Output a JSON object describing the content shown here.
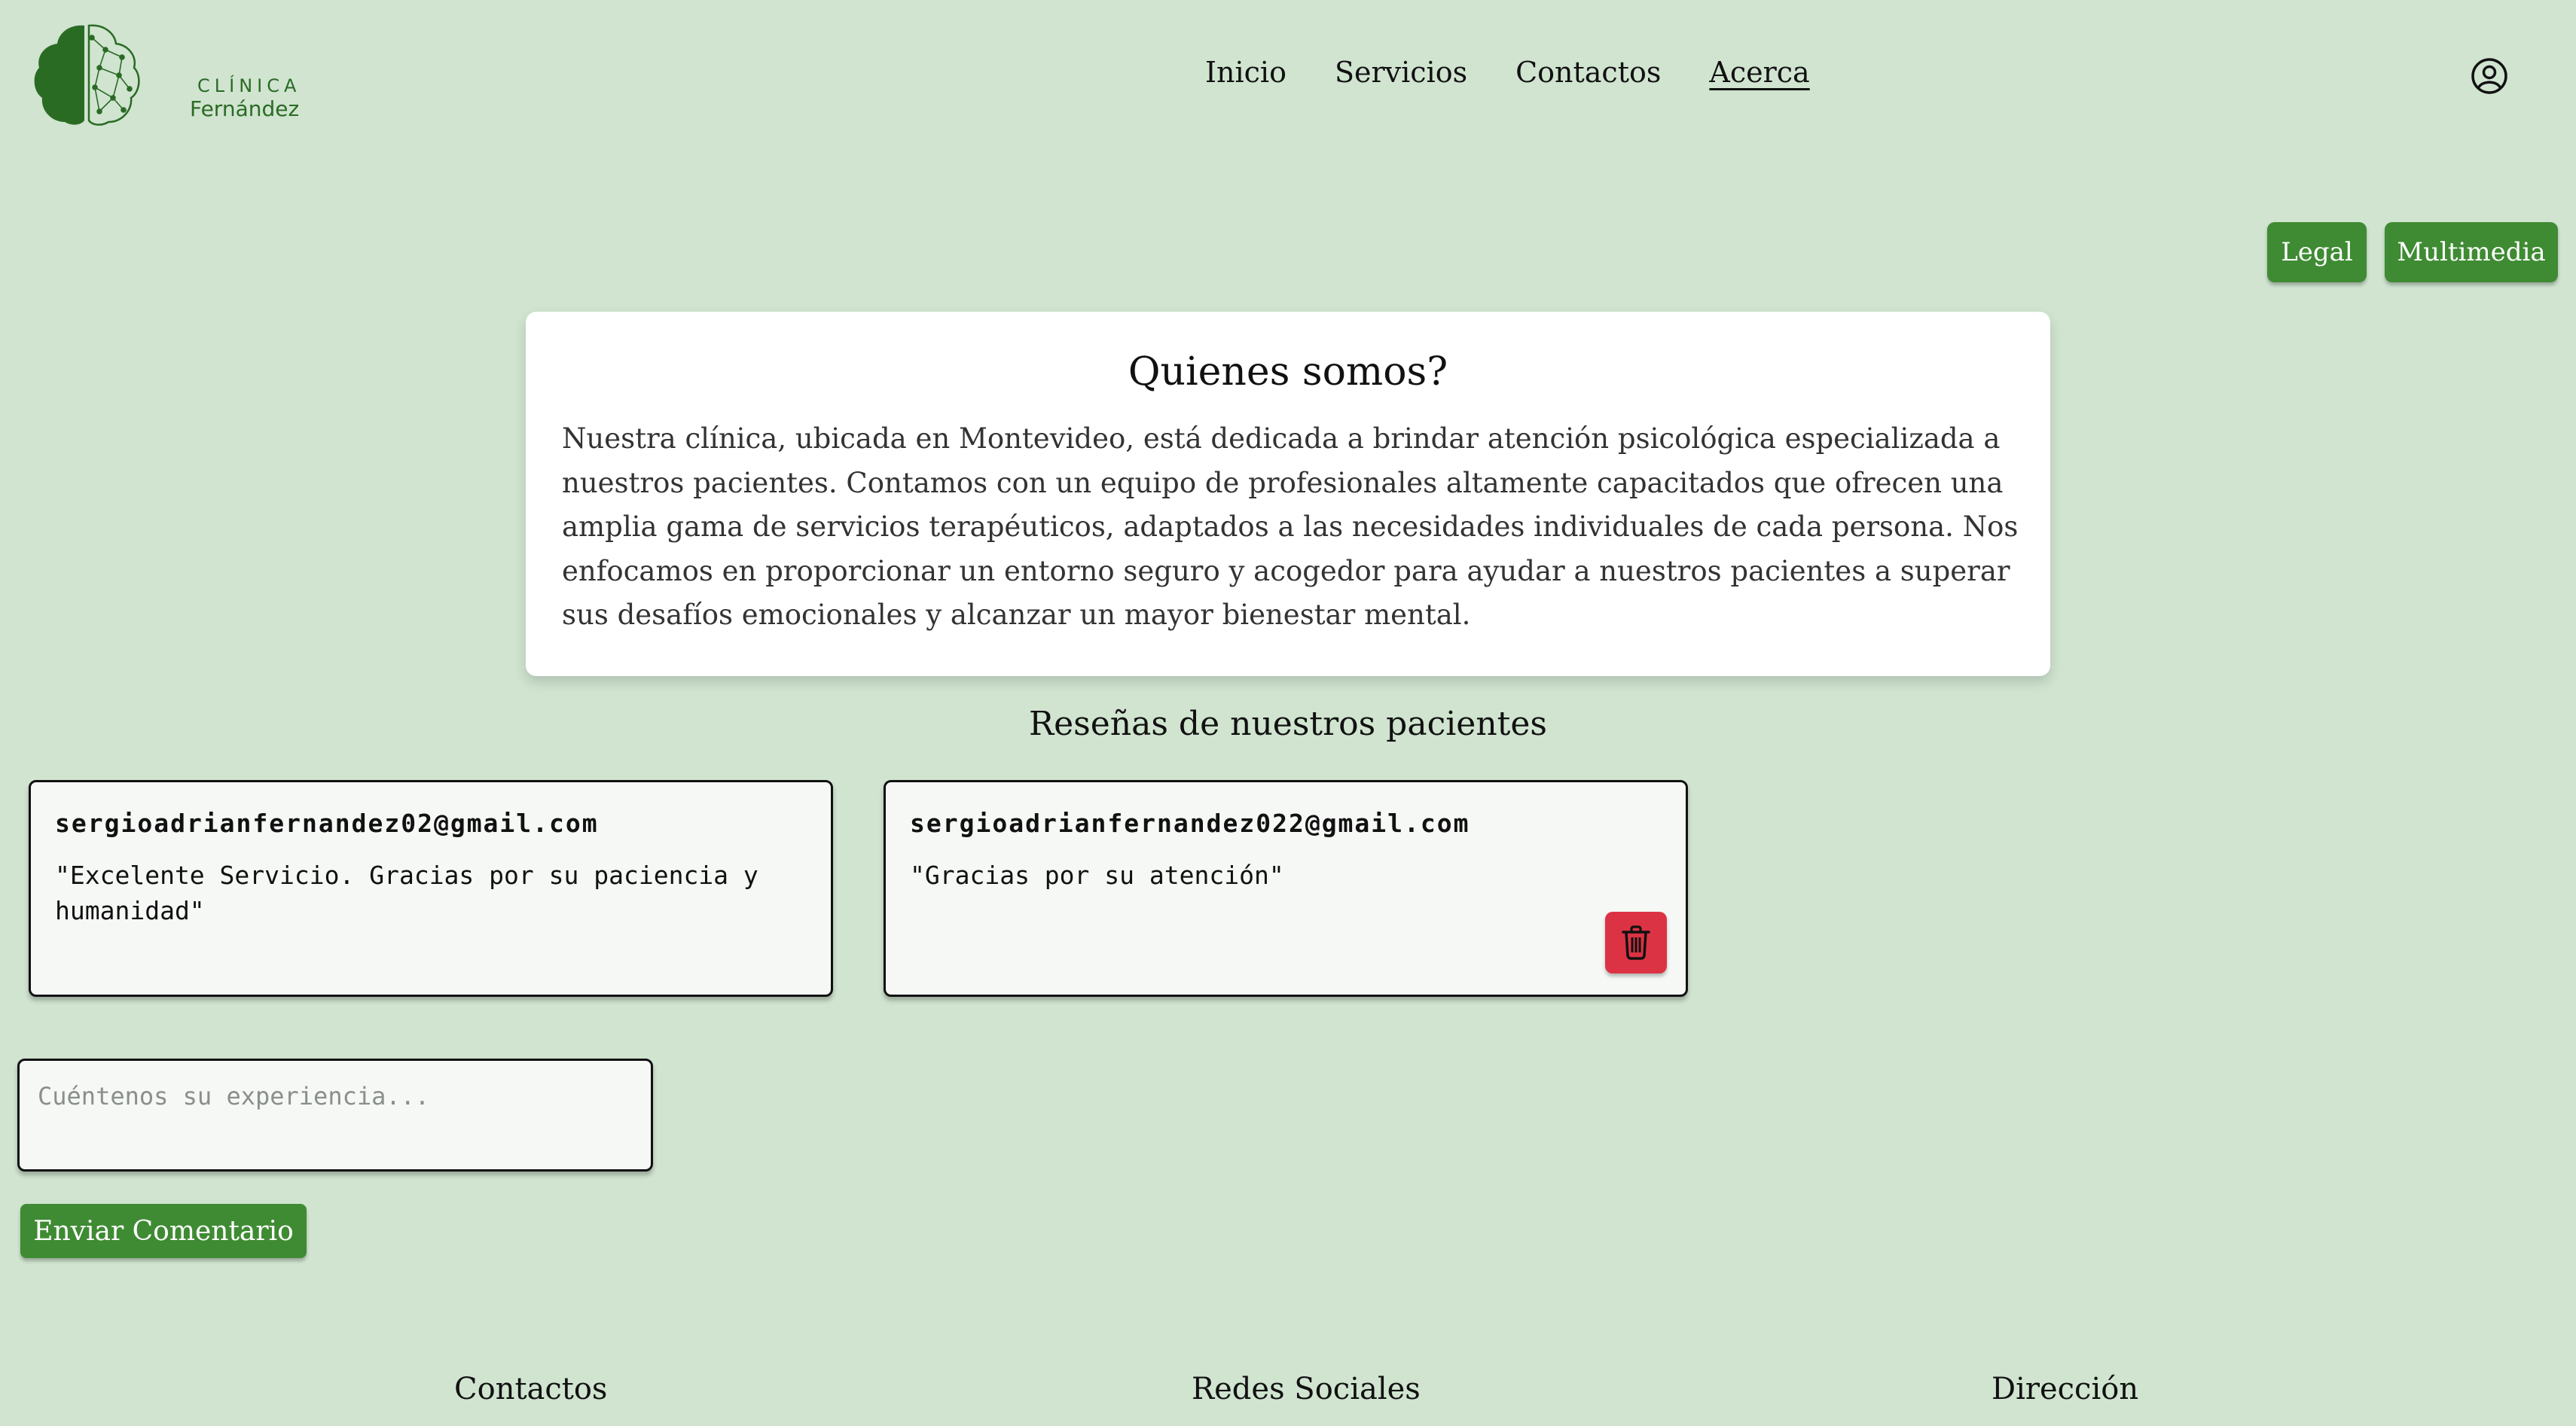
{
  "brand": {
    "line1": "CLÍNICA",
    "line2": "Fernández"
  },
  "nav": {
    "items": [
      "Inicio",
      "Servicios",
      "Contactos",
      "Acerca"
    ],
    "active": "Acerca"
  },
  "icons": {
    "user": "user-circle-icon",
    "delete": "trash-icon",
    "logo": "brain-logo-icon"
  },
  "buttons": {
    "legal": "Legal",
    "multimedia": "Multimedia",
    "send": "Enviar Comentario"
  },
  "about": {
    "title": "Quienes somos?",
    "text": "Nuestra clínica, ubicada en Montevideo, está dedicada a brindar atención psicológica especializada a nuestros pacientes. Contamos con un equipo de profesionales altamente capacitados que ofrecen una amplia gama de servicios terapéuticos, adaptados a las necesidades individuales de cada persona. Nos enfocamos en proporcionar un entorno seguro y acogedor para ayudar a nuestros pacientes a superar sus desafíos emocionales y alcanzar un mayor bienestar mental."
  },
  "reviews": {
    "title": "Reseñas de nuestros pacientes",
    "items": [
      {
        "email": "sergioadrianfernandez02@gmail.com",
        "text": "\"Excelente Servicio. Gracias por su paciencia y humanidad\""
      },
      {
        "email": "sergioadrianfernandez022@gmail.com",
        "text": "\"Gracias por su atención\""
      }
    ]
  },
  "comment": {
    "placeholder": "Cuéntenos su experiencia...",
    "value": ""
  },
  "footer": {
    "headings": [
      "Contactos",
      "Redes Sociales",
      "Dirección"
    ]
  },
  "colors": {
    "background": "#d0e4d0",
    "brand_green": "#2a6b23",
    "button_green": "#3f8b33",
    "delete_red": "#dc3344",
    "card_bg": "#ffffff"
  }
}
